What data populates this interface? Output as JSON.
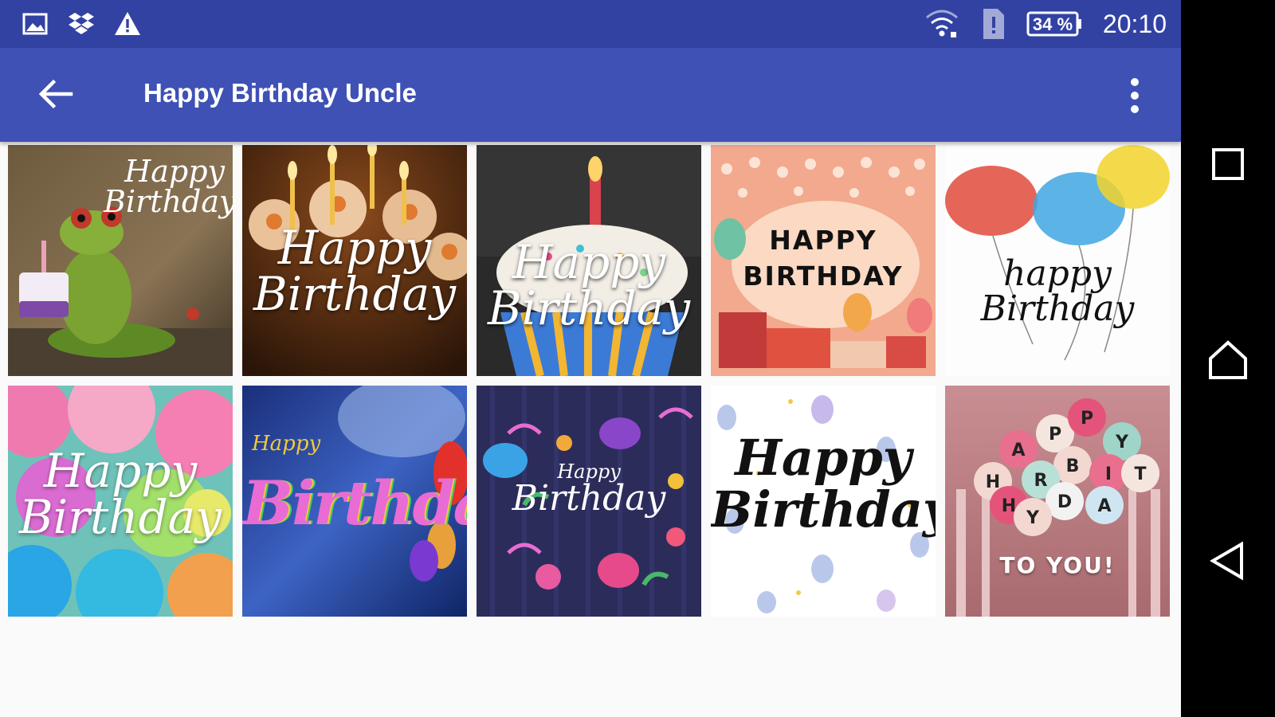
{
  "status_bar": {
    "left_icons": [
      "image-icon",
      "dropbox-icon",
      "warning-icon"
    ],
    "battery_text": "34 %",
    "time": "20:10",
    "right_icons": [
      "wifi-icon",
      "sim-alert-icon",
      "battery-icon"
    ]
  },
  "toolbar": {
    "title": "Happy Birthday Uncle",
    "back_icon": "arrow-left-icon",
    "menu_icon": "more-vertical-icon",
    "color": "#3f51b5",
    "status_color": "#3242a3"
  },
  "cards": [
    {
      "line1": "Happy",
      "line2": "Birthday",
      "style": "script-dark-frog"
    },
    {
      "line1": "Happy",
      "line2": "Birthday",
      "style": "script-candles"
    },
    {
      "line1": "Happy",
      "line2": "Birthday",
      "style": "script-cupcake"
    },
    {
      "line1": "HAPPY",
      "line2": "BIRTHDAY",
      "style": "block-peach"
    },
    {
      "line1": "happy",
      "line2": "Birthday",
      "style": "script-balloons-watercolor"
    },
    {
      "line1": "Happy",
      "line2": "Birthday",
      "style": "script-balloons-pastel"
    },
    {
      "line1": "Happy",
      "line2": "Birthday",
      "style": "rainbow-blue"
    },
    {
      "line1": "Happy",
      "line2": "Birthday",
      "style": "script-navy-floral"
    },
    {
      "line1": "Happy",
      "line2": "Birthday",
      "style": "script-white-balloons"
    },
    {
      "line1": "TO YOU!",
      "line2": "",
      "style": "balloons-letters"
    }
  ],
  "balloon_letters": [
    "H",
    "A",
    "P",
    "P",
    "Y",
    "B",
    "I",
    "R",
    "T",
    "H",
    "D",
    "A",
    "Y"
  ],
  "nav_bar": {
    "recents_icon": "square-icon",
    "home_icon": "home-icon",
    "back_icon": "triangle-back-icon"
  }
}
